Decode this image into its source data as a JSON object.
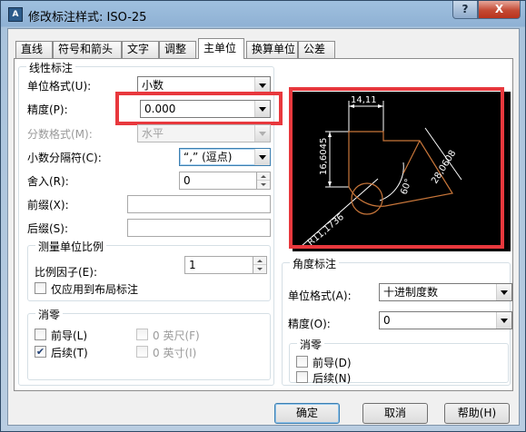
{
  "window": {
    "title": "修改标注样式: ISO-25",
    "help_btn": "?",
    "close_btn": "X"
  },
  "tabs": [
    {
      "label": "直线"
    },
    {
      "label": "符号和箭头"
    },
    {
      "label": "文字"
    },
    {
      "label": "调整"
    },
    {
      "label": "主单位"
    },
    {
      "label": "换算单位"
    },
    {
      "label": "公差"
    }
  ],
  "active_tab": "主单位",
  "linear": {
    "title": "线性标注",
    "unit_format_label": "单位格式(U):",
    "unit_format_value": "小数",
    "precision_label": "精度(P):",
    "precision_value": "0.000",
    "fraction_label": "分数格式(M):",
    "fraction_value": "水平",
    "decimal_sep_label": "小数分隔符(C):",
    "decimal_sep_value": "“,”  (逗点)",
    "round_label": "舍入(R):",
    "round_value": "0",
    "prefix_label": "前缀(X):",
    "prefix_value": "",
    "suffix_label": "后缀(S):",
    "suffix_value": ""
  },
  "scale": {
    "title": "测量单位比例",
    "factor_label": "比例因子(E):",
    "factor_value": "1",
    "layout_only_label": "仅应用到布局标注"
  },
  "zero_linear": {
    "title": "消零",
    "leading_label": "前导(L)",
    "trailing_label": "后续(T)",
    "feet_label": "0 英尺(F)",
    "inches_label": "0 英寸(I)",
    "leading_checked": false,
    "trailing_checked": true
  },
  "preview": {
    "dim_top": "14,11",
    "dim_left": "16,6045",
    "dim_right": "28,0608",
    "dim_angle": "60°",
    "dim_radius": "R11,1736"
  },
  "angular": {
    "title": "角度标注",
    "unit_format_label": "单位格式(A):",
    "unit_format_value": "十进制度数",
    "precision_label": "精度(O):",
    "precision_value": "0"
  },
  "zero_angular": {
    "title": "消零",
    "leading_label": "前导(D)",
    "trailing_label": "后续(N)"
  },
  "buttons": {
    "ok": "确定",
    "cancel": "取消",
    "help": "帮助(H)"
  },
  "colors": {
    "highlight_red": "#e8383d",
    "preview_bg": "#000000",
    "preview_shape": "#c8763a",
    "preview_dim": "#ffffff"
  }
}
